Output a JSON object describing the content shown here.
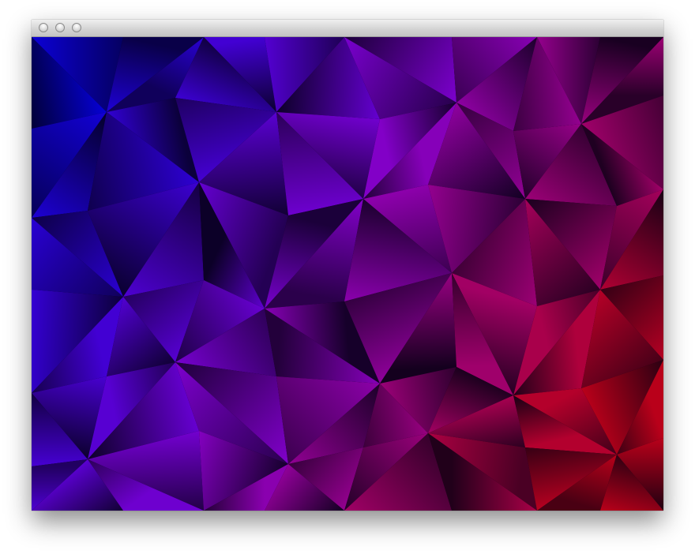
{
  "window": {
    "title": "",
    "controls": [
      {
        "name": "close-button",
        "icon": "traffic-light-close-icon"
      },
      {
        "name": "minimize-button",
        "icon": "traffic-light-minimize-icon"
      },
      {
        "name": "zoom-button",
        "icon": "traffic-light-zoom-icon"
      }
    ]
  },
  "artwork": {
    "description_free": true,
    "palette": {
      "blue": "#0000c8",
      "dark": "#000010",
      "purple": "#7a00c0",
      "red": "#b00018",
      "violet": "#8a0090"
    }
  }
}
